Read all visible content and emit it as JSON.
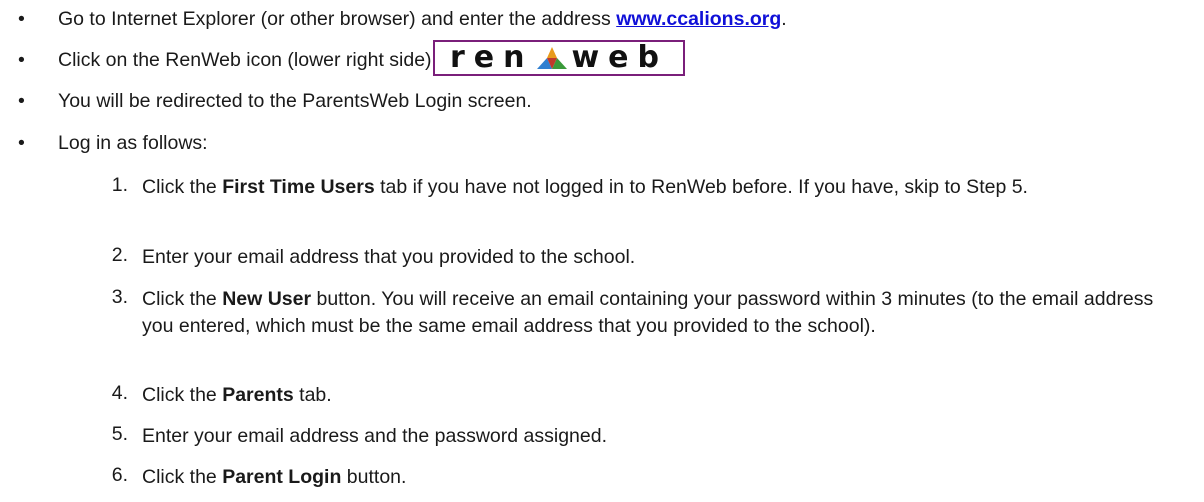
{
  "bullets": [
    {
      "before": "Go to Internet Explorer (or other browser) and enter the address ",
      "link": "www.ccalions.org",
      "after": "."
    },
    {
      "text": "Click on the RenWeb icon (lower right side)."
    },
    {
      "text": "You will be redirected to the ParentsWeb Login screen."
    },
    {
      "text": "Log in as follows:"
    }
  ],
  "bullet_symbol": "•",
  "logo": {
    "left": "ren",
    "right": "web",
    "border_color": "#7a1f7a"
  },
  "steps": [
    {
      "num": "1.",
      "before": "Click the ",
      "bold": "First Time Users",
      "after": " tab if you have not logged in to RenWeb before.  If you have, skip to Step 5."
    },
    {
      "num": "2.",
      "text": "Enter your email address that you provided to the school."
    },
    {
      "num": "3.",
      "before": "Click the ",
      "bold": "New User",
      "after": " button.  You will receive an email containing your password within 3 minutes (to the email address you entered, which must be the same email address that you provided to the school)."
    },
    {
      "num": "4.",
      "before": "Click the ",
      "bold": "Parents",
      "after": " tab."
    },
    {
      "num": "5.",
      "text": "Enter your email address and the password assigned."
    },
    {
      "num": "6.",
      "before": "Click the ",
      "bold": "Parent Login",
      "after": " button."
    }
  ],
  "colors": {
    "link": "#1010d8",
    "text": "#1a1a1a"
  }
}
